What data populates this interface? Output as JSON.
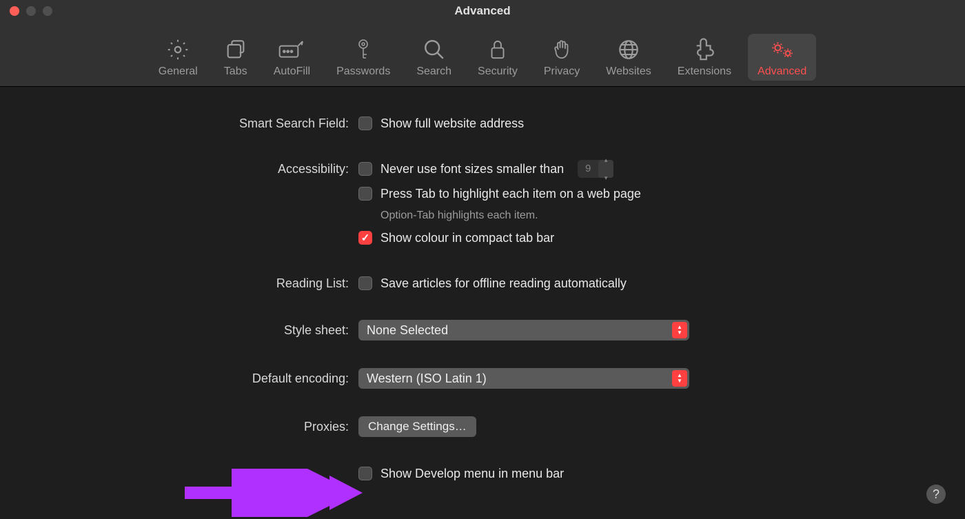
{
  "window": {
    "title": "Advanced"
  },
  "tabs": {
    "general": {
      "label": "General"
    },
    "tabs_": {
      "label": "Tabs"
    },
    "autofill": {
      "label": "AutoFill"
    },
    "passwords": {
      "label": "Passwords"
    },
    "search": {
      "label": "Search"
    },
    "security": {
      "label": "Security"
    },
    "privacy": {
      "label": "Privacy"
    },
    "websites": {
      "label": "Websites"
    },
    "extensions": {
      "label": "Extensions"
    },
    "advanced": {
      "label": "Advanced"
    }
  },
  "sections": {
    "smart_search": {
      "label": "Smart Search Field:"
    },
    "accessibility": {
      "label": "Accessibility:"
    },
    "reading_list": {
      "label": "Reading List:"
    },
    "style_sheet": {
      "label": "Style sheet:"
    },
    "default_encoding": {
      "label": "Default encoding:"
    },
    "proxies": {
      "label": "Proxies:"
    }
  },
  "options": {
    "show_full_address": {
      "label": "Show full website address",
      "checked": false
    },
    "never_smaller_than": {
      "label": "Never use font sizes smaller than",
      "checked": false,
      "value": "9"
    },
    "press_tab": {
      "label": "Press Tab to highlight each item on a web page",
      "checked": false
    },
    "press_tab_hint": "Option-Tab highlights each item.",
    "show_colour": {
      "label": "Show colour in compact tab bar",
      "checked": true
    },
    "save_offline": {
      "label": "Save articles for offline reading automatically",
      "checked": false
    },
    "style_sheet_value": "None Selected",
    "encoding_value": "Western (ISO Latin 1)",
    "proxies_button": "Change Settings…",
    "show_develop": {
      "label": "Show Develop menu in menu bar",
      "checked": false
    }
  }
}
